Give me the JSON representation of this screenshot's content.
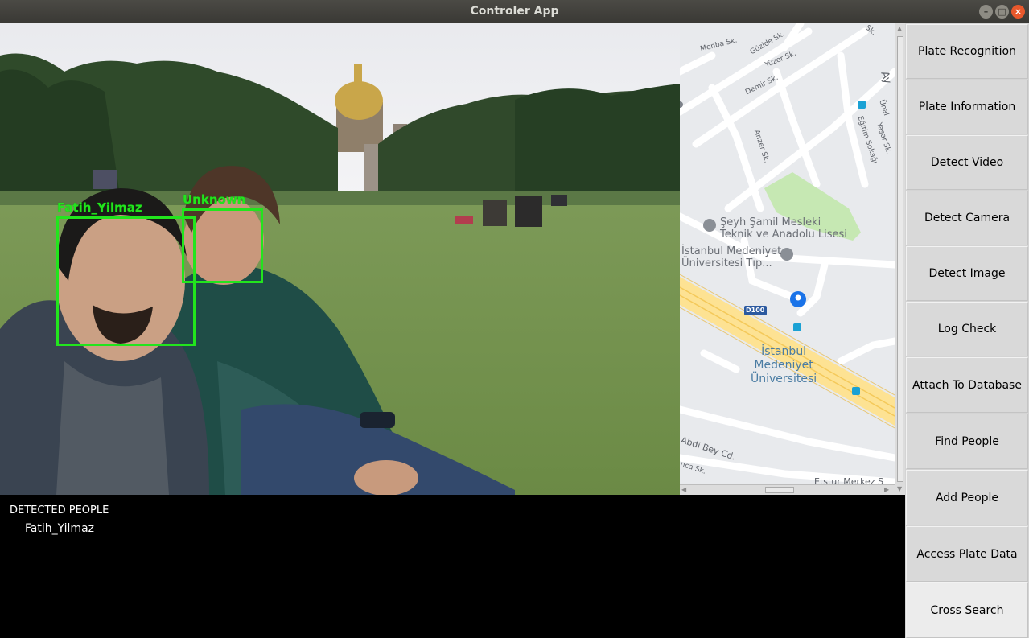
{
  "window": {
    "title": "Controler App",
    "controls": [
      "minimize",
      "maximize",
      "close"
    ]
  },
  "camera": {
    "faces": [
      {
        "label": "Fatih_Yilmaz",
        "color": "#22e51d"
      },
      {
        "label": "Unknown",
        "color": "#22e51d"
      }
    ]
  },
  "map": {
    "streets": [
      "Menba Sk.",
      "Güzide Sk.",
      "Yüzer Sk.",
      "Demir Sk.",
      "Anzer Sk.",
      "Eğitim Sokağı",
      "Yaşar Sk.",
      "Ünal",
      "Ay",
      "Abdi Bey Cd.",
      "nca Sk.",
      "Etstur Merkez S",
      "Sk."
    ],
    "pois": [
      "Şeyh Şamil Mesleki",
      "Teknik ve Anadolu Lisesi",
      "İstanbul Medeniyet",
      "Üniversitesi Tıp..."
    ],
    "university": [
      "İstanbul",
      "Medeniyet",
      "Üniversitesi"
    ],
    "road_badge": "D100"
  },
  "output": {
    "title": "DETECTED PEOPLE",
    "people": [
      "Fatih_Yilmaz"
    ]
  },
  "sidebar": {
    "buttons": [
      {
        "label": "Plate Recognition"
      },
      {
        "label": "Plate Information"
      },
      {
        "label": "Detect Video"
      },
      {
        "label": "Detect Camera"
      },
      {
        "label": "Detect Image"
      },
      {
        "label": "Log Check"
      },
      {
        "label": "Attach To Database"
      },
      {
        "label": "Find People"
      },
      {
        "label": "Add People"
      },
      {
        "label": "Access Plate Data"
      },
      {
        "label": "Cross Search"
      }
    ]
  }
}
